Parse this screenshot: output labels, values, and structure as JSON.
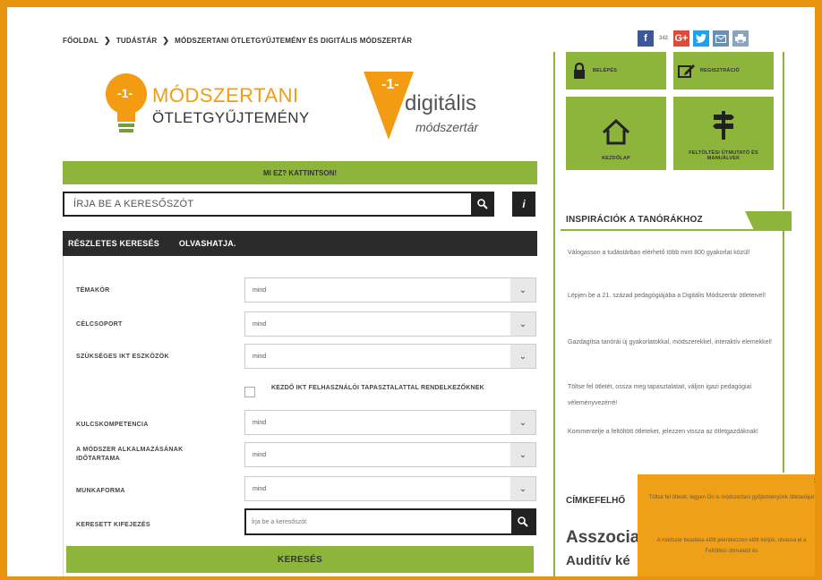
{
  "breadcrumb": {
    "home": "FŐOLDAL",
    "second": "TUDÁSTÁR",
    "current": "MÓDSZERTANI ÖTLETGYŰJTEMÉNY ÉS DIGITÁLIS MÓDSZERTÁR"
  },
  "social": {
    "fb": "f",
    "count": "342",
    "gplus": "G+"
  },
  "logos": {
    "left_line1": "MÓDSZERTANI",
    "left_line2": "ÖTLETGYŰJTEMÉNY",
    "right_line1": "digitális",
    "right_line2": "módszertár"
  },
  "whatis_label": "MI EZ? KATTINTSON!",
  "search": {
    "placeholder": "ÍRJA BE A KERESŐSZÓT",
    "info": "i"
  },
  "advanced": {
    "tab1": "RÉSZLETES KERESÉS",
    "tab2": "OLVASHATJA."
  },
  "filters": {
    "temakor": {
      "label": "TÉMAKÖR",
      "value": "mind"
    },
    "celcsoport": {
      "label": "CÉLCSOPORT",
      "value": "mind"
    },
    "ikt": {
      "label": "SZÜKSÉGES IKT ESZKÖZÖK",
      "value": "mind"
    },
    "checkbox_label": "KEZDŐ IKT FELHASZNÁLÓI TAPASZTALATTAL RENDELKEZŐKNEK",
    "kulcs": {
      "label": "KULCSKOMPETENCIA",
      "value": "mind"
    },
    "idotartam": {
      "label": "A MÓDSZER ALKALMAZÁSÁNAK IDŐTARTAMA",
      "value": "mind"
    },
    "munkaforma": {
      "label": "MUNKAFORMA",
      "value": "mind"
    },
    "kifejezes": {
      "label": "KERESETT KIFEJEZÉS",
      "placeholder": "Írja be a keresőszót"
    }
  },
  "submit_label": "KERESÉS",
  "sidebar": {
    "login": "BELÉPÉS",
    "register": "REGISZTRÁCIÓ",
    "home": "KEZDŐLAP",
    "upload": "FELTÖLTÉSI ÚTMUTATÓ ÉS MANUÁLVEK",
    "inspiration_title": "INSPIRÁCIÓK A TANÓRÁKHOZ",
    "insp1": "Válogasson a tudástárban elérhető több mint 800 gyakorlat közül!",
    "insp2": "Lépjen be a 21. század pedagógiájába a Digitális Módszertár ötleteivel!",
    "insp3": "Gazdagítsa tanórái új gyakorlatokkal, módszerekkel, interaktív elemekkel!",
    "insp4": "Töltse fel ötletét, ossza meg tapasztalatait, váljon igazi pedagógiai véleményvezérré!",
    "insp5": "Kommentelje a feltöltött ötleteket, jelezzen vissza az ötletgazdáknak!",
    "tags_title": "CÍMKEFELHŐ",
    "tag1": "Asszocia",
    "tag2": "Auditív ké"
  },
  "popup": {
    "close": "×",
    "text1": "Töltse fel ötletét, legyen Ön is módszertani gyűjteményünk ötletadója!",
    "text2": "A módszer beadása előtt jelentkezzen előtt kérjük, olvassa el a Feltöltési útmutatót és"
  },
  "colors": {
    "frame": "#e8940e",
    "green": "#8db53c",
    "orange": "#f39c12",
    "dark": "#2b2b2b"
  }
}
